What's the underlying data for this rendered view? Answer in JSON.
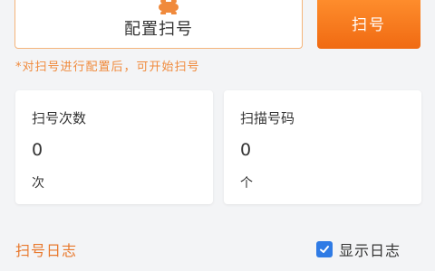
{
  "config_card": {
    "label": "配置扫号",
    "icon": "bone-icon",
    "icon_color": "#f08a3c"
  },
  "scan_button": {
    "label": "扫号",
    "gradient": [
      "#ff8f2e",
      "#f06a12"
    ]
  },
  "hint": "*对扫号进行配置后，可开始扫号",
  "stats": [
    {
      "title": "扫号次数",
      "value": "0",
      "unit": "次"
    },
    {
      "title": "扫描号码",
      "value": "0",
      "unit": "个"
    }
  ],
  "log": {
    "title": "扫号日志",
    "show_label": "显示日志",
    "show_checked": true
  },
  "colors": {
    "accent": "#f08a3c",
    "checkbox": "#2f7be5",
    "background": "#f3f4f6"
  }
}
